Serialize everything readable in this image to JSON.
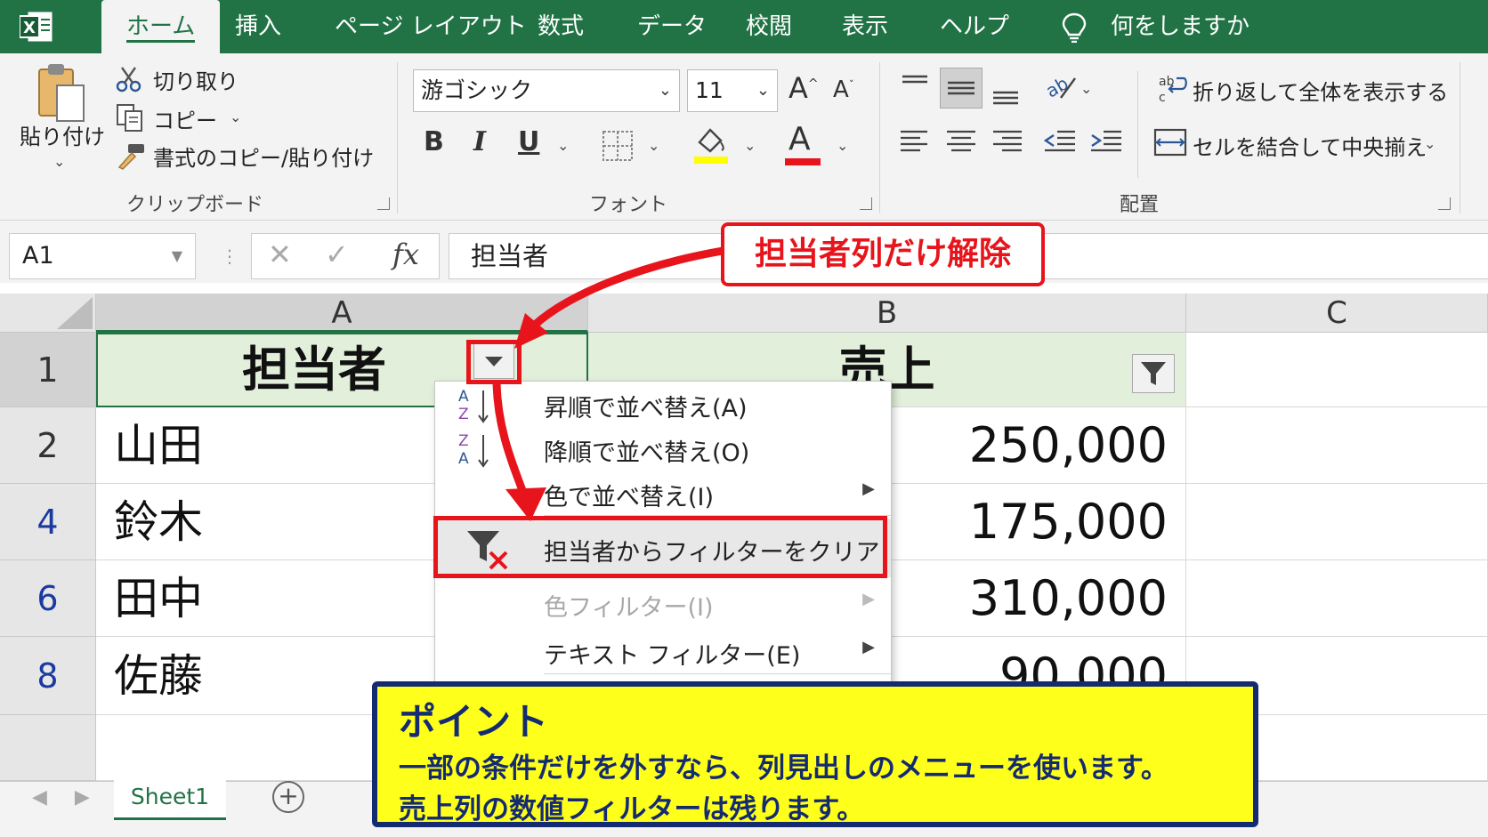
{
  "tabs": [
    "ホーム",
    "挿入",
    "ページ レイアウト",
    "数式",
    "データ",
    "校閲",
    "表示",
    "ヘルプ"
  ],
  "tell_me": "何をしますか",
  "ribbon": {
    "clipboard": {
      "paste": "貼り付け",
      "cut": "切り取り",
      "copy": "コピー",
      "format_painter": "書式のコピー/貼り付け",
      "label": "クリップボード"
    },
    "font": {
      "name": "游ゴシック",
      "size": "11",
      "bold": "B",
      "italic": "I",
      "underline": "U",
      "font_color_glyph": "A",
      "label": "フォント"
    },
    "alignment": {
      "wrap": "折り返して全体を表示する",
      "merge": "セルを結合して中央揃え",
      "label": "配置"
    }
  },
  "formula_bar": {
    "name_box": "A1",
    "fx": "fx",
    "content": "担当者"
  },
  "columns": [
    "A",
    "B",
    "C"
  ],
  "rows": [
    {
      "num": "1",
      "a": "担当者",
      "b": "売上"
    },
    {
      "num": "2",
      "a": "山田",
      "b": "250,000"
    },
    {
      "num": "4",
      "a": "鈴木",
      "b": "175,000"
    },
    {
      "num": "6",
      "a": "田中",
      "b": "310,000"
    },
    {
      "num": "8",
      "a": "佐藤",
      "b": "90,000"
    }
  ],
  "sheet_tab": "Sheet1",
  "menu": {
    "items": [
      {
        "label": "昇順で並べ替え(A)"
      },
      {
        "label": "降順で並べ替え(O)"
      },
      {
        "label": "色で並べ替え(I)"
      },
      {
        "label": "担当者からフィルターをクリア"
      },
      {
        "label": "色フィルター(I)"
      },
      {
        "label": "テキスト フィルター(E)"
      }
    ]
  },
  "callout": "担当者列だけ解除",
  "point": {
    "title": "ポイント",
    "line1": "一部の条件だけを外すなら、列見出しのメニューを使います。",
    "line2": "売上列の数値フィルターは残ります。"
  },
  "colors": {
    "excel_green": "#217346",
    "header_fill": "#e2efda",
    "highlight_red": "#e8141c",
    "note_yellow": "#ffff1c",
    "note_navy": "#142b72"
  }
}
